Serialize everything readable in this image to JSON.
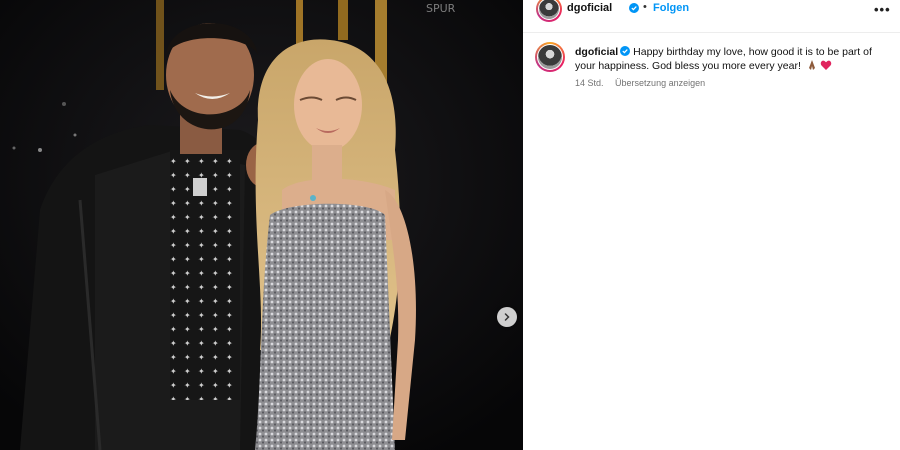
{
  "post": {
    "username": "dgoficial",
    "follow_label": "Folgen",
    "separator": "•",
    "more_label": "•••"
  },
  "caption": {
    "username": "dgoficial",
    "text": "Happy birthday my love, how good it is to be part of your happiness. God bless you more every year!",
    "time": "14 Std.",
    "translate_label": "Übersetzung anzeigen"
  },
  "media": {
    "background_sign": "SPUR",
    "carousel_next": "chevron-right"
  },
  "colors": {
    "follow": "#0095f6",
    "verified": "#0095f6",
    "meta": "#737373"
  }
}
